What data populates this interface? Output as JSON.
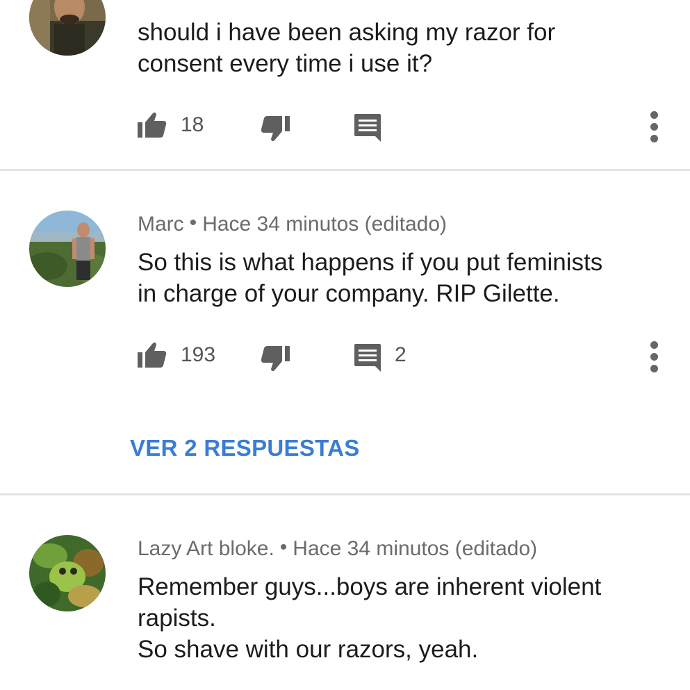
{
  "comments": [
    {
      "author": "",
      "time": "",
      "lines": [
        "should i have been asking my razor for",
        "consent every time i use it?"
      ],
      "likes": "18",
      "replies": ""
    },
    {
      "author": "Marc",
      "time": "Hace 34 minutos (editado)",
      "lines": [
        "So this is what happens if you put feminists",
        "in charge of your company. RIP Gilette."
      ],
      "likes": "193",
      "replies": "2",
      "view_replies_label": "VER 2 RESPUESTAS"
    },
    {
      "author": "Lazy Art bloke.",
      "time": "Hace 34 minutos (editado)",
      "lines": [
        "Remember guys...boys are inherent violent",
        "rapists.",
        "So shave with our razors, yeah."
      ]
    }
  ],
  "separator": "•",
  "colors": {
    "link": "#3a7cd6",
    "meta": "#6b6b6b",
    "icon": "#5f5f5f",
    "divider": "#e3e3e3"
  },
  "icons": [
    "thumbs-up-icon",
    "thumbs-down-icon",
    "reply-icon",
    "more-vert-icon",
    "avatar"
  ]
}
